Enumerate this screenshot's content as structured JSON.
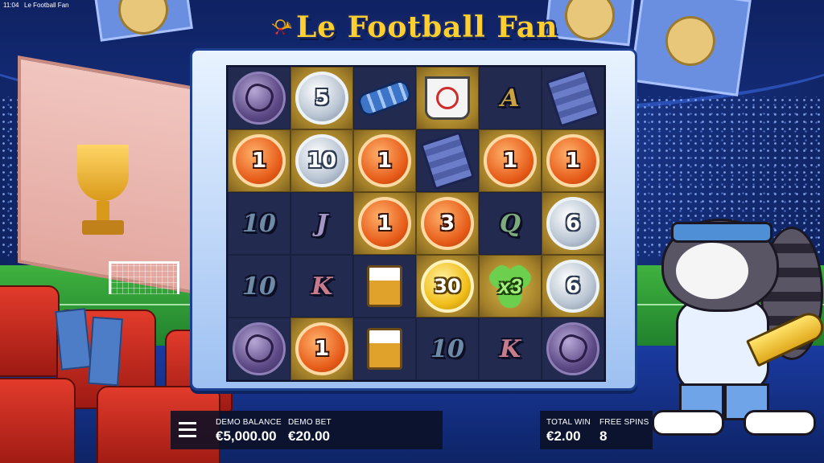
{
  "status_bar": {
    "time": "11:04",
    "tab_title": "Le Football Fan"
  },
  "logo": {
    "text": "Le Football Fan"
  },
  "grid": {
    "rows": [
      [
        {
          "sym": "ball",
          "hl": false
        },
        {
          "sym": "silver",
          "value": "5",
          "hl": true
        },
        {
          "sym": "scarf",
          "hl": false
        },
        {
          "sym": "cup",
          "hl": true
        },
        {
          "sym": "letter",
          "value": "A",
          "cls": "a",
          "hl": false
        },
        {
          "sym": "tickets",
          "hl": false
        }
      ],
      [
        {
          "sym": "bronze",
          "value": "1",
          "hl": true
        },
        {
          "sym": "silver",
          "value": "10",
          "hl": true
        },
        {
          "sym": "bronze",
          "value": "1",
          "hl": true
        },
        {
          "sym": "tickets",
          "hl": false
        },
        {
          "sym": "bronze",
          "value": "1",
          "hl": true
        },
        {
          "sym": "bronze",
          "value": "1",
          "hl": true
        }
      ],
      [
        {
          "sym": "letter",
          "value": "10",
          "cls": "ten",
          "hl": false
        },
        {
          "sym": "letter",
          "value": "J",
          "cls": "j",
          "hl": false
        },
        {
          "sym": "bronze",
          "value": "1",
          "hl": true
        },
        {
          "sym": "bronze",
          "value": "3",
          "hl": true
        },
        {
          "sym": "letter",
          "value": "Q",
          "cls": "q",
          "hl": false
        },
        {
          "sym": "silver",
          "value": "6",
          "hl": true
        }
      ],
      [
        {
          "sym": "letter",
          "value": "10",
          "cls": "ten",
          "hl": false
        },
        {
          "sym": "letter",
          "value": "K",
          "cls": "k",
          "hl": false
        },
        {
          "sym": "beer",
          "hl": false
        },
        {
          "sym": "gold",
          "value": "30",
          "hl": true
        },
        {
          "sym": "clover",
          "value": "x3",
          "hl": true
        },
        {
          "sym": "silver",
          "value": "6",
          "hl": true
        }
      ],
      [
        {
          "sym": "ball",
          "hl": false
        },
        {
          "sym": "bronze",
          "value": "1",
          "hl": true
        },
        {
          "sym": "beer",
          "hl": false
        },
        {
          "sym": "letter",
          "value": "10",
          "cls": "ten",
          "hl": false
        },
        {
          "sym": "letter",
          "value": "K",
          "cls": "k",
          "hl": false
        },
        {
          "sym": "ball",
          "hl": false
        }
      ]
    ]
  },
  "hud": {
    "menu_icon": "hamburger-menu-icon",
    "balance_label": "DEMO BALANCE",
    "balance_value": "€5,000.00",
    "bet_label": "DEMO BET",
    "bet_value": "€20.00",
    "total_win_label": "TOTAL WIN",
    "total_win_value": "€2.00",
    "free_spins_label": "FREE SPINS",
    "free_spins_value": "8"
  }
}
